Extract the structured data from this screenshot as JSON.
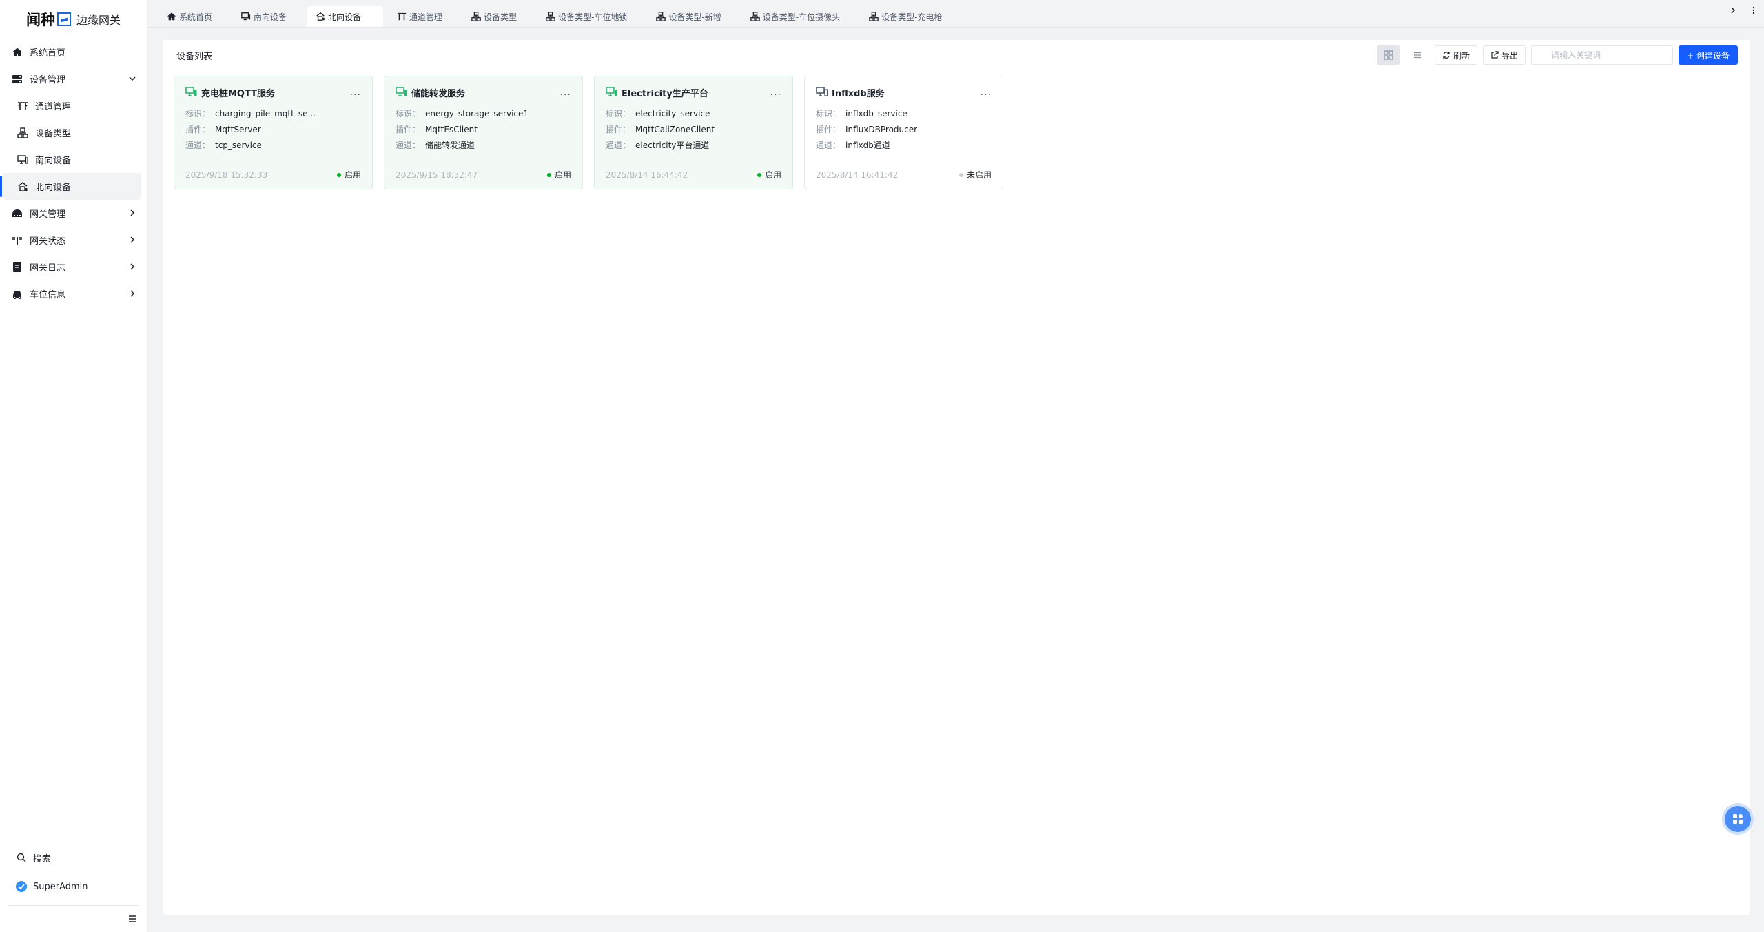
{
  "app": {
    "brand": "闻种",
    "product": "边缘网关"
  },
  "sidebar": {
    "items": [
      {
        "label": "系统首页"
      },
      {
        "label": "设备管理"
      },
      {
        "label": "通道管理"
      },
      {
        "label": "设备类型"
      },
      {
        "label": "南向设备"
      },
      {
        "label": "北向设备"
      },
      {
        "label": "网关管理"
      },
      {
        "label": "网关状态"
      },
      {
        "label": "网关日志"
      },
      {
        "label": "车位信息"
      }
    ],
    "search_label": "搜索",
    "user_name": "SuperAdmin"
  },
  "tabs": [
    {
      "label": "系统首页"
    },
    {
      "label": "南向设备"
    },
    {
      "label": "北向设备"
    },
    {
      "label": "通道管理"
    },
    {
      "label": "设备类型"
    },
    {
      "label": "设备类型-车位地锁"
    },
    {
      "label": "设备类型-新增"
    },
    {
      "label": "设备类型-车位摄像头"
    },
    {
      "label": "设备类型-充电枪"
    }
  ],
  "main": {
    "title": "设备列表",
    "refresh_label": "刷新",
    "export_label": "导出",
    "search_placeholder": "请输入关键词",
    "create_label": "+ 创建设备",
    "field_labels": {
      "id": "标识：",
      "plugin": "插件：",
      "channel": "通道："
    },
    "more_label": "...",
    "devices": [
      {
        "name": "充电桩MQTT服务",
        "id": "charging_pile_mqtt_se...",
        "plugin": "MqttServer",
        "channel": "tcp_service",
        "time": "2025/9/18 15:32:33",
        "status": "启用"
      },
      {
        "name": "储能转发服务",
        "id": "energy_storage_service1",
        "plugin": "MqttEsClient",
        "channel": "储能转发通道",
        "time": "2025/9/15 18:32:47",
        "status": "启用"
      },
      {
        "name": "Electricity生产平台",
        "id": "electricity_service",
        "plugin": "MqttCaliZoneClient",
        "channel": "electricity平台通道",
        "time": "2025/8/14 16:44:42",
        "status": "启用"
      },
      {
        "name": "Inflxdb服务",
        "id": "inflxdb_service",
        "plugin": "InfluxDBProducer",
        "channel": "inflxdb通道",
        "time": "2025/8/14 16:41:42",
        "status": "未启用"
      }
    ]
  },
  "colors": {
    "primary": "#165dff",
    "enabled_dot": "#00b42a",
    "disabled_dot": "#c9cdd4",
    "enabled_icon": "#2bb673",
    "disabled_icon": "#4e5969"
  }
}
